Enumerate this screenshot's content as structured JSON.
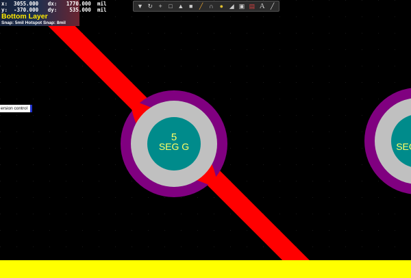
{
  "hud": {
    "row1": "x:  3055.000   dx:   1770.000  mil",
    "row2": "y:  -370.000   dy:    535.000  mil",
    "layer": "Bottom Layer",
    "snap": "Snap: 5mil Hotspot Snap: 8mil"
  },
  "toolbar": {
    "icons": [
      "filter-icon",
      "route-icon",
      "cross-icon",
      "select-rect-icon",
      "component-icon",
      "rect-icon",
      "line-icon",
      "arc-icon",
      "pad-icon",
      "fill-icon",
      "region-icon",
      "graph-icon",
      "text-icon",
      "dimension-icon"
    ]
  },
  "tooltip": {
    "text": "ersion control"
  },
  "pads": [
    {
      "number": "5",
      "net": "SEG G"
    },
    {
      "number": "",
      "net": "SEG"
    }
  ],
  "colors": {
    "background": "#000000",
    "track": "#ff0000",
    "pad_ring": "#800080",
    "pad_copper": "#c0c0c0",
    "pad_hole": "#008b8b",
    "overlay": "#ffff00",
    "label": "#ffff66"
  }
}
